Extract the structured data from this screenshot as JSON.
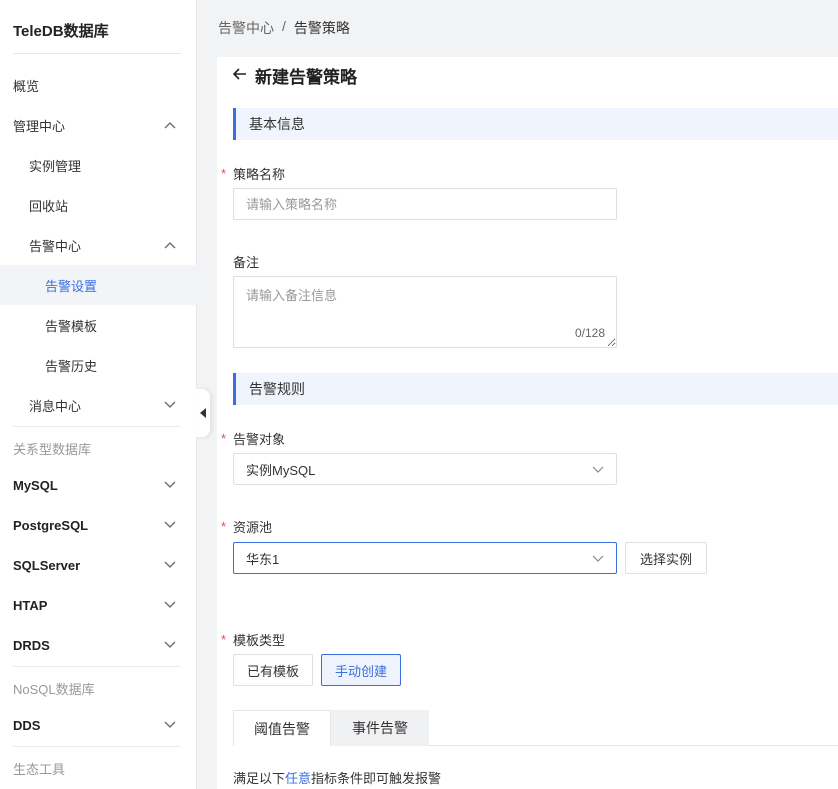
{
  "brand": "TeleDB数据库",
  "nav": {
    "overview": "概览",
    "management": "管理中心",
    "instances": "实例管理",
    "recycle": "回收站",
    "alarm_center": "告警中心",
    "alarm_settings": "告警设置",
    "alarm_templates": "告警模板",
    "alarm_history": "告警历史",
    "message_center": "消息中心",
    "group_relational": "关系型数据库",
    "mysql": "MySQL",
    "postgresql": "PostgreSQL",
    "sqlserver": "SQLServer",
    "htap": "HTAP",
    "drds": "DRDS",
    "group_nosql": "NoSQL数据库",
    "dds": "DDS",
    "group_tools": "生态工具"
  },
  "breadcrumb": {
    "parent": "告警中心",
    "sep": "/",
    "current": "告警策略"
  },
  "page": {
    "title": "新建告警策略"
  },
  "sections": {
    "basic": "基本信息",
    "rules": "告警规则"
  },
  "form": {
    "policy_name": {
      "label": "策略名称",
      "placeholder": "请输入策略名称"
    },
    "remark": {
      "label": "备注",
      "placeholder": "请输入备注信息",
      "counter": "0/128"
    },
    "alarm_target": {
      "label": "告警对象",
      "value": "实例MySQL"
    },
    "resource_pool": {
      "label": "资源池",
      "value": "华东1",
      "select_button": "选择实例"
    },
    "template_type": {
      "label": "模板类型",
      "existing": "已有模板",
      "manual": "手动创建"
    }
  },
  "tabs": {
    "threshold": "阈值告警",
    "event": "事件告警"
  },
  "hint": {
    "prefix": "满足以下",
    "link": "任意",
    "suffix": "指标条件即可触发报警"
  },
  "colors": {
    "accent": "#3a6fe0",
    "required": "#e34d4d"
  }
}
